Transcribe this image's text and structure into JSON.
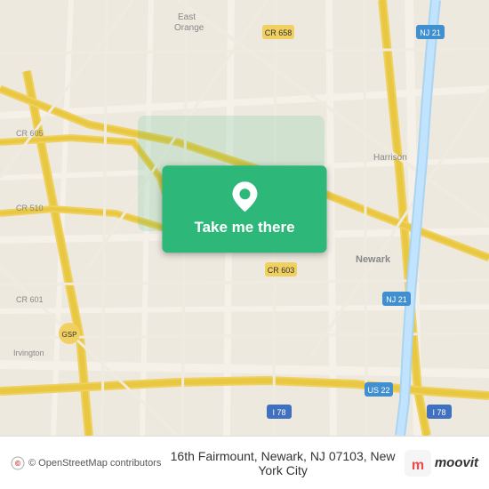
{
  "map": {
    "center_lat": 40.7357,
    "center_lng": -74.1724,
    "location": "16th Fairmount, Newark, NJ 07103",
    "city": "New York City"
  },
  "button": {
    "label": "Take me there"
  },
  "bottom_bar": {
    "attribution": "© OpenStreetMap contributors",
    "address": "16th Fairmount, Newark, NJ 07103, New York City"
  },
  "icons": {
    "location_pin": "location-pin-icon",
    "moovit": "moovit-logo-icon"
  }
}
